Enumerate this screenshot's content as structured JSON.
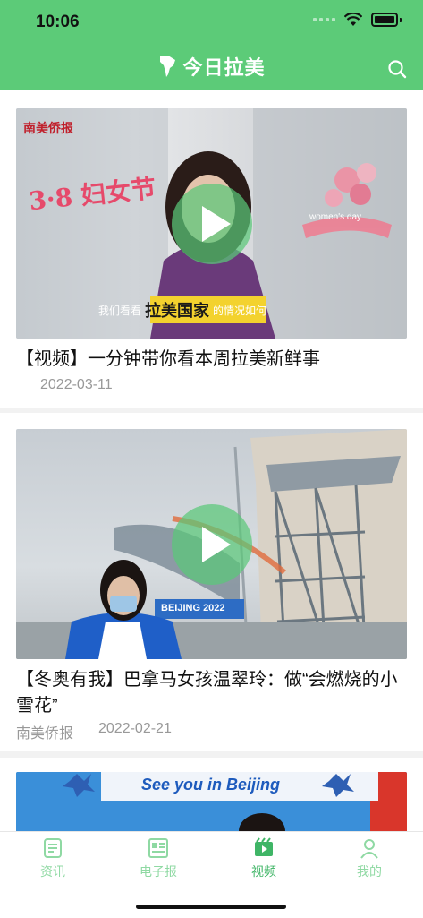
{
  "status": {
    "time": "10:06"
  },
  "header": {
    "title": "今日拉美"
  },
  "feed": [
    {
      "title": "【视频】一分钟带你看本周拉美新鲜事",
      "source": "",
      "date": "2022-03-11",
      "overlay": {
        "logo": "南美侨报",
        "caption_pre": "我们看看",
        "caption_highlight": "拉美国家",
        "caption_post": "的情况如何",
        "banner_left": "3·8 妇女节",
        "banner_right": "women's day"
      }
    },
    {
      "title": "【冬奥有我】巴拿马女孩温翠玲：做“会燃烧的小雪花”",
      "source": "南美侨报",
      "date": "2022-02-21",
      "overlay": {
        "sign": "BEIJING 2022"
      }
    },
    {
      "title": "",
      "source": "",
      "date": "",
      "overlay": {
        "banner": "See you in Beijing"
      }
    }
  ],
  "tabbar": {
    "items": [
      {
        "label": "资讯",
        "icon": "news-icon"
      },
      {
        "label": "电子报",
        "icon": "newspaper-icon"
      },
      {
        "label": "视频",
        "icon": "video-icon",
        "active": true
      },
      {
        "label": "我的",
        "icon": "profile-icon"
      }
    ]
  },
  "colors": {
    "brand": "#5ccb78",
    "active_tab": "#3fb566",
    "inactive_tab": "#8fd9a3"
  }
}
